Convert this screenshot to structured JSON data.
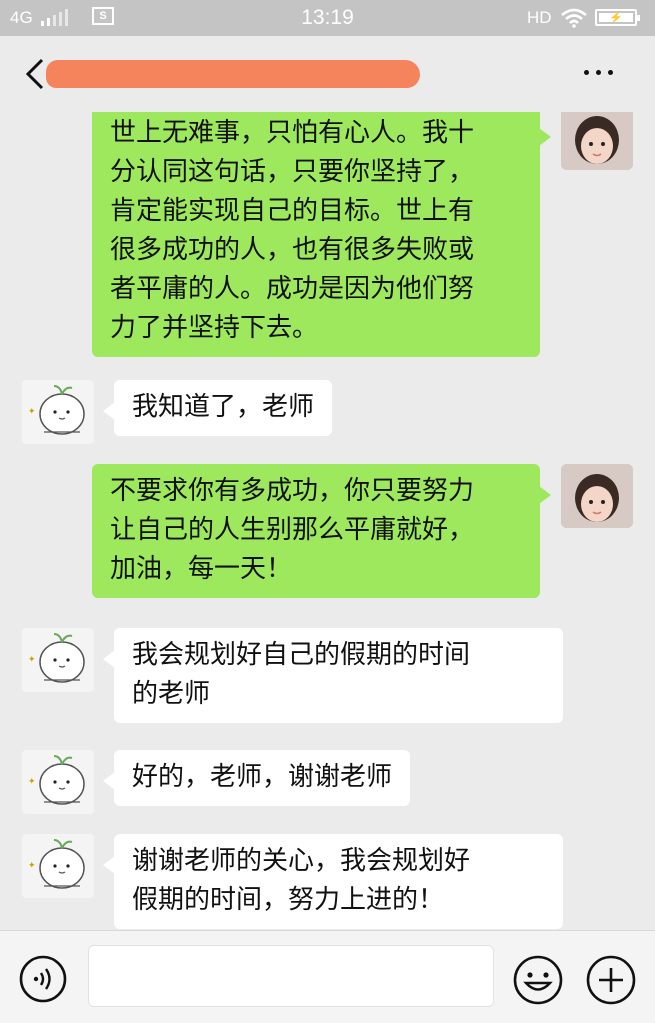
{
  "status_bar": {
    "network": "4G",
    "time": "13:19",
    "hd": "HD",
    "sim_icon": "sim-card-icon",
    "battery_icon": "battery-charging-icon"
  },
  "header": {
    "back_icon": "chevron-left-icon",
    "more_icon": "more-dots-icon"
  },
  "messages": [
    {
      "sender": "me",
      "lines": [
        "世上无难事，只怕有心人。我十",
        "分认同这句话，只要你坚持了，",
        "肯定能实现自己的目标。世上有",
        "很多成功的人，也有很多失败或",
        "者平庸的人。成功是因为他们努",
        "力了并坚持下去。"
      ]
    },
    {
      "sender": "other",
      "lines": [
        "我知道了，老师"
      ]
    },
    {
      "sender": "me",
      "lines": [
        "不要求你有多成功，你只要努力",
        "让自己的人生别那么平庸就好，",
        "加油，每一天！"
      ]
    },
    {
      "sender": "other",
      "lines": [
        "我会规划好自己的假期的时间",
        "的老师"
      ]
    },
    {
      "sender": "other",
      "lines": [
        "好的，老师，谢谢老师"
      ]
    },
    {
      "sender": "other",
      "lines": [
        "谢谢老师的关心，我会规划好",
        "假期的时间，努力上进的！"
      ]
    }
  ],
  "input_bar": {
    "voice_icon": "voice-icon",
    "emoji_icon": "emoji-icon",
    "plus_icon": "plus-icon"
  },
  "colors": {
    "my_bubble": "#9ee85d",
    "other_bubble": "#ffffff",
    "background": "#ebebeb",
    "redaction": "#f5845c"
  }
}
